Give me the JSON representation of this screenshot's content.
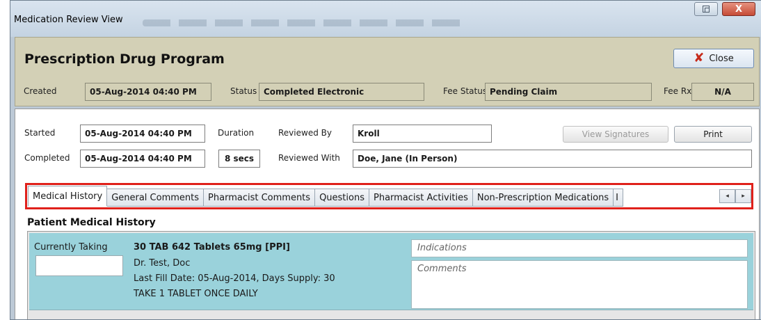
{
  "window": {
    "title": "Medication Review View",
    "close_glyph": "X"
  },
  "header": {
    "title": "Prescription Drug Program",
    "close_label": "Close",
    "created_label": "Created",
    "created_value": "05-Aug-2014 04:40 PM",
    "status_label": "Status",
    "status_value": "Completed Electronic",
    "fee_status_label": "Fee Status",
    "fee_status_value": "Pending Claim",
    "fee_rx_label": "Fee Rx",
    "fee_rx_value": "N/A"
  },
  "review": {
    "started_label": "Started",
    "started_value": "05-Aug-2014 04:40 PM",
    "completed_label": "Completed",
    "completed_value": "05-Aug-2014 04:40 PM",
    "duration_label": "Duration",
    "duration_value": "8 secs",
    "reviewed_by_label": "Reviewed By",
    "reviewed_by_value": "Kroll",
    "reviewed_with_label": "Reviewed With",
    "reviewed_with_value": "Doe, Jane (In Person)",
    "view_signatures_label": "View Signatures",
    "print_label": "Print"
  },
  "tabs": [
    {
      "label": "Medical History",
      "active": true
    },
    {
      "label": "General Comments"
    },
    {
      "label": "Pharmacist Comments"
    },
    {
      "label": "Questions"
    },
    {
      "label": "Pharmacist Activities"
    },
    {
      "label": "Non-Prescription Medications"
    },
    {
      "label": "I"
    }
  ],
  "tab_scroll": {
    "left": "◂",
    "right": "▸"
  },
  "medical_history": {
    "section_title": "Patient Medical History",
    "item": {
      "status_label": "Currently Taking",
      "drug": "30 TAB 642 Tablets 65mg [PPI]",
      "doctor": "Dr. Test, Doc",
      "fill_info": "Last Fill Date: 05-Aug-2014, Days Supply: 30",
      "directions": "TAKE 1 TABLET ONCE DAILY",
      "indications_placeholder": "Indications",
      "comments_placeholder": "Comments"
    }
  },
  "colors": {
    "header_bg": "#d3d0b6",
    "highlight_border": "#e0211b",
    "row_bg": "#9ad2db"
  }
}
